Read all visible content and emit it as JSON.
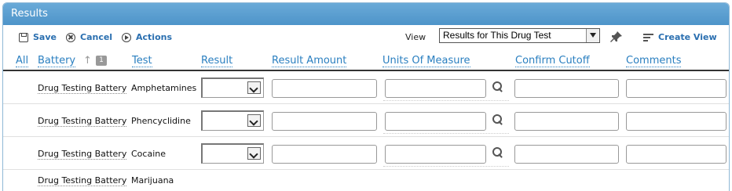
{
  "panel": {
    "title": "Results"
  },
  "toolbar": {
    "save_label": "Save",
    "cancel_label": "Cancel",
    "actions_label": "Actions",
    "view_label": "View",
    "view_selected": "Results for This Drug Test",
    "create_view_label": "Create View"
  },
  "columns": {
    "all": "All",
    "battery": "Battery",
    "sort_badge": "1",
    "test": "Test",
    "result": "Result",
    "result_amount": "Result Amount",
    "units": "Units Of Measure",
    "confirm_cutoff": "Confirm Cutoff",
    "comments": "Comments"
  },
  "rows": [
    {
      "battery": "Drug Testing Battery",
      "test": "Amphetamines",
      "result": "",
      "result_amount": "",
      "units": "",
      "confirm_cutoff": "",
      "comments": ""
    },
    {
      "battery": "Drug Testing Battery",
      "test": "Phencyclidine",
      "result": "",
      "result_amount": "",
      "units": "",
      "confirm_cutoff": "",
      "comments": ""
    },
    {
      "battery": "Drug Testing Battery",
      "test": "Cocaine",
      "result": "",
      "result_amount": "",
      "units": "",
      "confirm_cutoff": "",
      "comments": ""
    },
    {
      "battery": "Drug Testing Battery",
      "test": "Marijuana"
    }
  ],
  "colors": {
    "titlebar": "#5c9fd0",
    "link": "#2a7fc0"
  }
}
